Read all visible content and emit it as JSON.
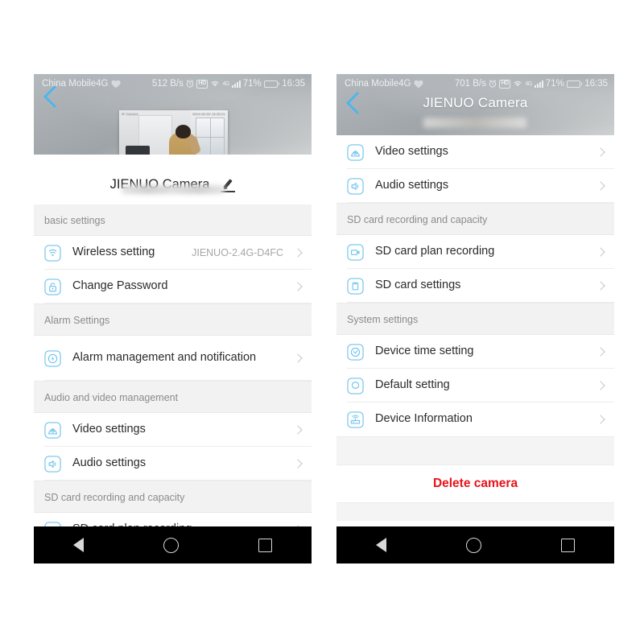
{
  "screens": [
    {
      "id": "left",
      "status_bar": {
        "carrier": "China Mobile4G",
        "heart_icon": "heart-icon",
        "data_rate": "512 B/s",
        "alarm_icon": "alarm-clock-icon",
        "hd_badge": "HD",
        "wifi_icon": "wifi-icon",
        "network_type": "4G",
        "signal_icon": "signal-bars-icon",
        "battery_percent": "71%",
        "battery_icon": "battery-icon",
        "time": "16:35"
      },
      "header": {
        "back_icon": "back-chevron-icon",
        "title": "",
        "camera_name": "JIENUO Camera",
        "edit_icon": "pencil-edit-icon",
        "device_id_redacted": "",
        "thumbnail": {
          "osd_left": "IP Camera",
          "osd_right": "2019-03-09 16:35:21"
        }
      },
      "sections": [
        {
          "title": "basic settings",
          "items": [
            {
              "label": "Wireless setting",
              "value": "JIENUO-2.4G-D4FC",
              "icon": "wifi-icon",
              "chevron": true
            },
            {
              "label": "Change Password",
              "value": "",
              "icon": "lock-icon",
              "chevron": true
            }
          ]
        },
        {
          "title": "Alarm Settings",
          "items": [
            {
              "label": "Alarm management and notification",
              "value": "",
              "icon": "alarm-bolt-icon",
              "chevron": true
            }
          ]
        },
        {
          "title": "Audio and video management",
          "items": [
            {
              "label": "Video settings",
              "value": "",
              "icon": "camera-dome-icon",
              "chevron": true
            },
            {
              "label": "Audio settings",
              "value": "",
              "icon": "speaker-icon",
              "chevron": true
            }
          ]
        },
        {
          "title": "SD card recording and capacity",
          "items": [
            {
              "label": "SD card plan recording",
              "value": "",
              "icon": "video-camera-icon",
              "chevron": true
            }
          ]
        }
      ],
      "nav_bar": {
        "back_icon": "nav-back-icon",
        "home_icon": "nav-home-icon",
        "recent_icon": "nav-recent-apps-icon"
      }
    },
    {
      "id": "right",
      "status_bar": {
        "carrier": "China Mobile4G",
        "heart_icon": "heart-icon",
        "data_rate": "701 B/s",
        "alarm_icon": "alarm-clock-icon",
        "hd_badge": "HD",
        "wifi_icon": "wifi-icon",
        "network_type": "4G",
        "signal_icon": "signal-bars-icon",
        "battery_percent": "71%",
        "battery_icon": "battery-icon",
        "time": "16:35"
      },
      "header": {
        "back_icon": "back-chevron-icon",
        "title": "JIENUO Camera",
        "device_id_redacted": ""
      },
      "sections": [
        {
          "title": "",
          "items": [
            {
              "label": "Video settings",
              "value": "",
              "icon": "camera-dome-icon",
              "chevron": true
            },
            {
              "label": "Audio settings",
              "value": "",
              "icon": "speaker-icon",
              "chevron": true
            }
          ]
        },
        {
          "title": "SD card recording and capacity",
          "items": [
            {
              "label": "SD card plan recording",
              "value": "",
              "icon": "video-camera-icon",
              "chevron": true
            },
            {
              "label": "SD card settings",
              "value": "",
              "icon": "sd-card-icon",
              "chevron": true
            }
          ]
        },
        {
          "title": "System settings",
          "items": [
            {
              "label": "Device time setting",
              "value": "",
              "icon": "clock-icon",
              "chevron": true
            },
            {
              "label": "Default setting",
              "value": "",
              "icon": "gear-icon",
              "chevron": true
            },
            {
              "label": "Device Information",
              "value": "",
              "icon": "router-icon",
              "chevron": true
            }
          ]
        }
      ],
      "delete_button": {
        "label": "Delete camera",
        "color": "#e8131a"
      },
      "nav_bar": {
        "back_icon": "nav-back-icon",
        "home_icon": "nav-home-icon",
        "recent_icon": "nav-recent-apps-icon"
      }
    }
  ],
  "theme": {
    "accent": "#49b6ef",
    "icon_stroke": "#6fc3ef",
    "section_bg": "#f2f2f2",
    "label_color": "#2b2b2b",
    "muted_color": "#a6a6a6",
    "danger": "#e8131a"
  }
}
